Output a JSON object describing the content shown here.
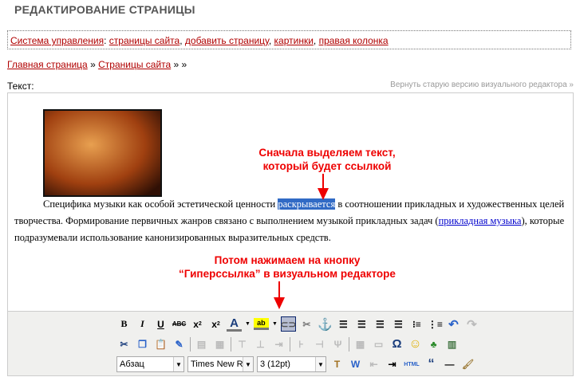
{
  "title": "РЕДАКТИРОВАНИЕ СТРАНИЦЫ",
  "nav": {
    "items": [
      "Система управления",
      "страницы сайта",
      "добавить страницу",
      "картинки",
      "правая колонка"
    ]
  },
  "breadcrumb": {
    "items": [
      "Главная страница",
      "Страницы сайта"
    ],
    "sep": "»",
    "tail": "» »"
  },
  "text_label": "Текст:",
  "old_version_link": "Вернуть старую версию визуального редактора »",
  "content": {
    "before": "Специфика музыки как особой эстетической ценности ",
    "selected": "раскрывается",
    "middle": " в соотношении прикладных и художественных целей творчества. Формирование первичных жанров связано с выполнением музыкой прикладных задач (",
    "link": "прикладная музыка",
    "after": "), которые подразумевали использование канонизированных выразительных средств."
  },
  "annotations": {
    "first": "Сначала выделяем текст,\nкоторый будет ссылкой",
    "second": "Потом нажимаем на кнопку\n“Гиперссылка” в визуальном редакторе"
  },
  "toolbar": {
    "format": "Абзац",
    "font": "Times New Roman",
    "size": "3 (12pt)",
    "html": "HTML"
  },
  "colors": {
    "link": "#b00000",
    "annotation": "#ee0000",
    "selection": "#316ac5"
  }
}
